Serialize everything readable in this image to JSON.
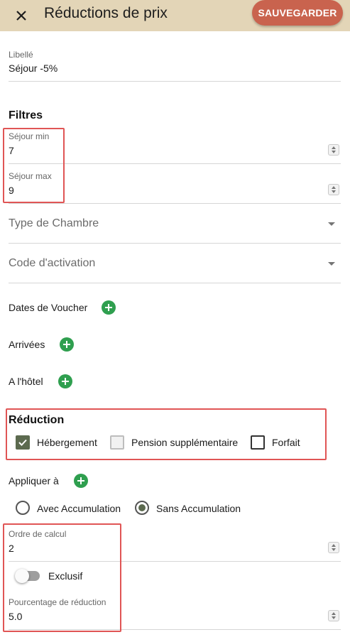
{
  "header": {
    "title": "Réductions de prix",
    "save_label": "SAUVEGARDER",
    "close_icon": "close-icon",
    "bg_color": "#e3d5b7",
    "accent_color": "#c9634e"
  },
  "libelle": {
    "label": "Libellé",
    "value": "Séjour -5%"
  },
  "filters": {
    "title": "Filtres",
    "sejour_min": {
      "label": "Séjour min",
      "value": "7"
    },
    "sejour_max": {
      "label": "Séjour max",
      "value": "9"
    },
    "type_chambre": {
      "placeholder": "Type de Chambre"
    },
    "code_activation": {
      "placeholder": "Code d'activation"
    },
    "dates_voucher": {
      "label": "Dates de Voucher"
    },
    "arrivees": {
      "label": "Arrivées"
    },
    "a_l_hotel": {
      "label": "A l'hôtel"
    }
  },
  "reduction": {
    "title": "Réduction",
    "options": [
      {
        "label": "Hébergement",
        "checked": true
      },
      {
        "label": "Pension supplémentaire",
        "checked": false,
        "disabled": true
      },
      {
        "label": "Forfait",
        "checked": false
      }
    ]
  },
  "appliquer": {
    "label": "Appliquer à",
    "radios": [
      {
        "label": "Avec Accumulation",
        "selected": false
      },
      {
        "label": "Sans Accumulation",
        "selected": true
      }
    ]
  },
  "ordre_calcul": {
    "label": "Ordre de calcul",
    "value": "2"
  },
  "exclusif": {
    "label": "Exclusif",
    "on": false
  },
  "pourcentage": {
    "label": "Pourcentage de réduction",
    "value": "5.0"
  }
}
